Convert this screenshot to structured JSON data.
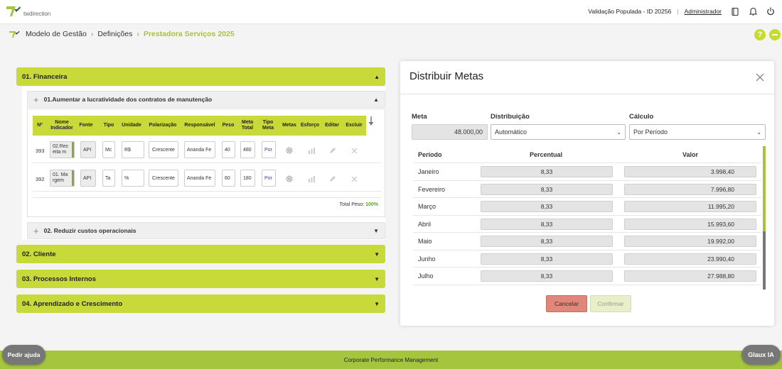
{
  "header": {
    "logo_text": "twdirection",
    "environment": "Validação Populada - ID 20256",
    "separator": "|",
    "user": "Administrador"
  },
  "breadcrumb": {
    "items": [
      "Modelo de Gestão",
      "Definições",
      "Prestadora Serviços 2025"
    ],
    "help_label": "?"
  },
  "sections": [
    {
      "label": "01. Financeira"
    },
    {
      "label": "02. Cliente"
    },
    {
      "label": "03. Processos Internos"
    },
    {
      "label": "04. Aprendizado e Crescimento"
    }
  ],
  "objectives": [
    {
      "label": "01.Aumentar a lucratividade dos contratos de manutenção"
    },
    {
      "label": "02. Reduzir custos operacionais"
    }
  ],
  "table": {
    "headers": [
      "Nº",
      "Nome Indicador",
      "Fonte",
      "Tipo",
      "Unidade",
      "Polarização",
      "Responsável",
      "Peso",
      "Meta Total",
      "Tipo Meta",
      "Metas",
      "Esforço",
      "Editar",
      "Excluir"
    ],
    "rows": [
      {
        "num": "393",
        "nome": "02.Rec eita m",
        "fonte": "API",
        "tipo": "Mc",
        "unidade": "R$",
        "polarizacao": "Crescente",
        "responsavel": "Ananda Fe",
        "peso": "40",
        "meta_total": "480",
        "tipo_meta": "Por"
      },
      {
        "num": "392",
        "nome": "01. Ma rgem",
        "fonte": "API",
        "tipo": "Ta",
        "unidade": "%",
        "polarizacao": "Crescente",
        "responsavel": "Ananda Fe",
        "peso": "60",
        "meta_total": "180",
        "tipo_meta": "Por"
      }
    ],
    "total_label": "Total Peso:",
    "total_value": "100%"
  },
  "modal": {
    "title": "Distribuir Metas",
    "meta_label": "Meta",
    "meta_value": "48.000,00",
    "distribuicao_label": "Distribuição",
    "distribuicao_value": "Automático",
    "calculo_label": "Cálculo",
    "calculo_value": "Por Período",
    "grid_headers": {
      "periodo": "Período",
      "percentual": "Percentual",
      "valor": "Valor"
    },
    "rows": [
      {
        "periodo": "Janeiro",
        "percentual": "8,33",
        "valor": "3.998,40"
      },
      {
        "periodo": "Fevereiro",
        "percentual": "8,33",
        "valor": "7.996,80"
      },
      {
        "periodo": "Março",
        "percentual": "8,33",
        "valor": "11.995,20"
      },
      {
        "periodo": "Abril",
        "percentual": "8,33",
        "valor": "15.993,60"
      },
      {
        "periodo": "Maio",
        "percentual": "8,33",
        "valor": "19.992,00"
      },
      {
        "periodo": "Junho",
        "percentual": "8,33",
        "valor": "23.990,40"
      },
      {
        "periodo": "Julho",
        "percentual": "8,33",
        "valor": "27.988,80"
      }
    ],
    "cancel_label": "Cancelar",
    "confirm_label": "Confirmar"
  },
  "footer": {
    "text": "Corporate Performance Management",
    "help_button": "Pedir ajuda",
    "ai_button": "Glaux IA"
  },
  "colors": {
    "accent": "#c8d93a",
    "footer": "#a6c53f",
    "cancel": "#e0877a",
    "total_ok": "#5da22a"
  }
}
